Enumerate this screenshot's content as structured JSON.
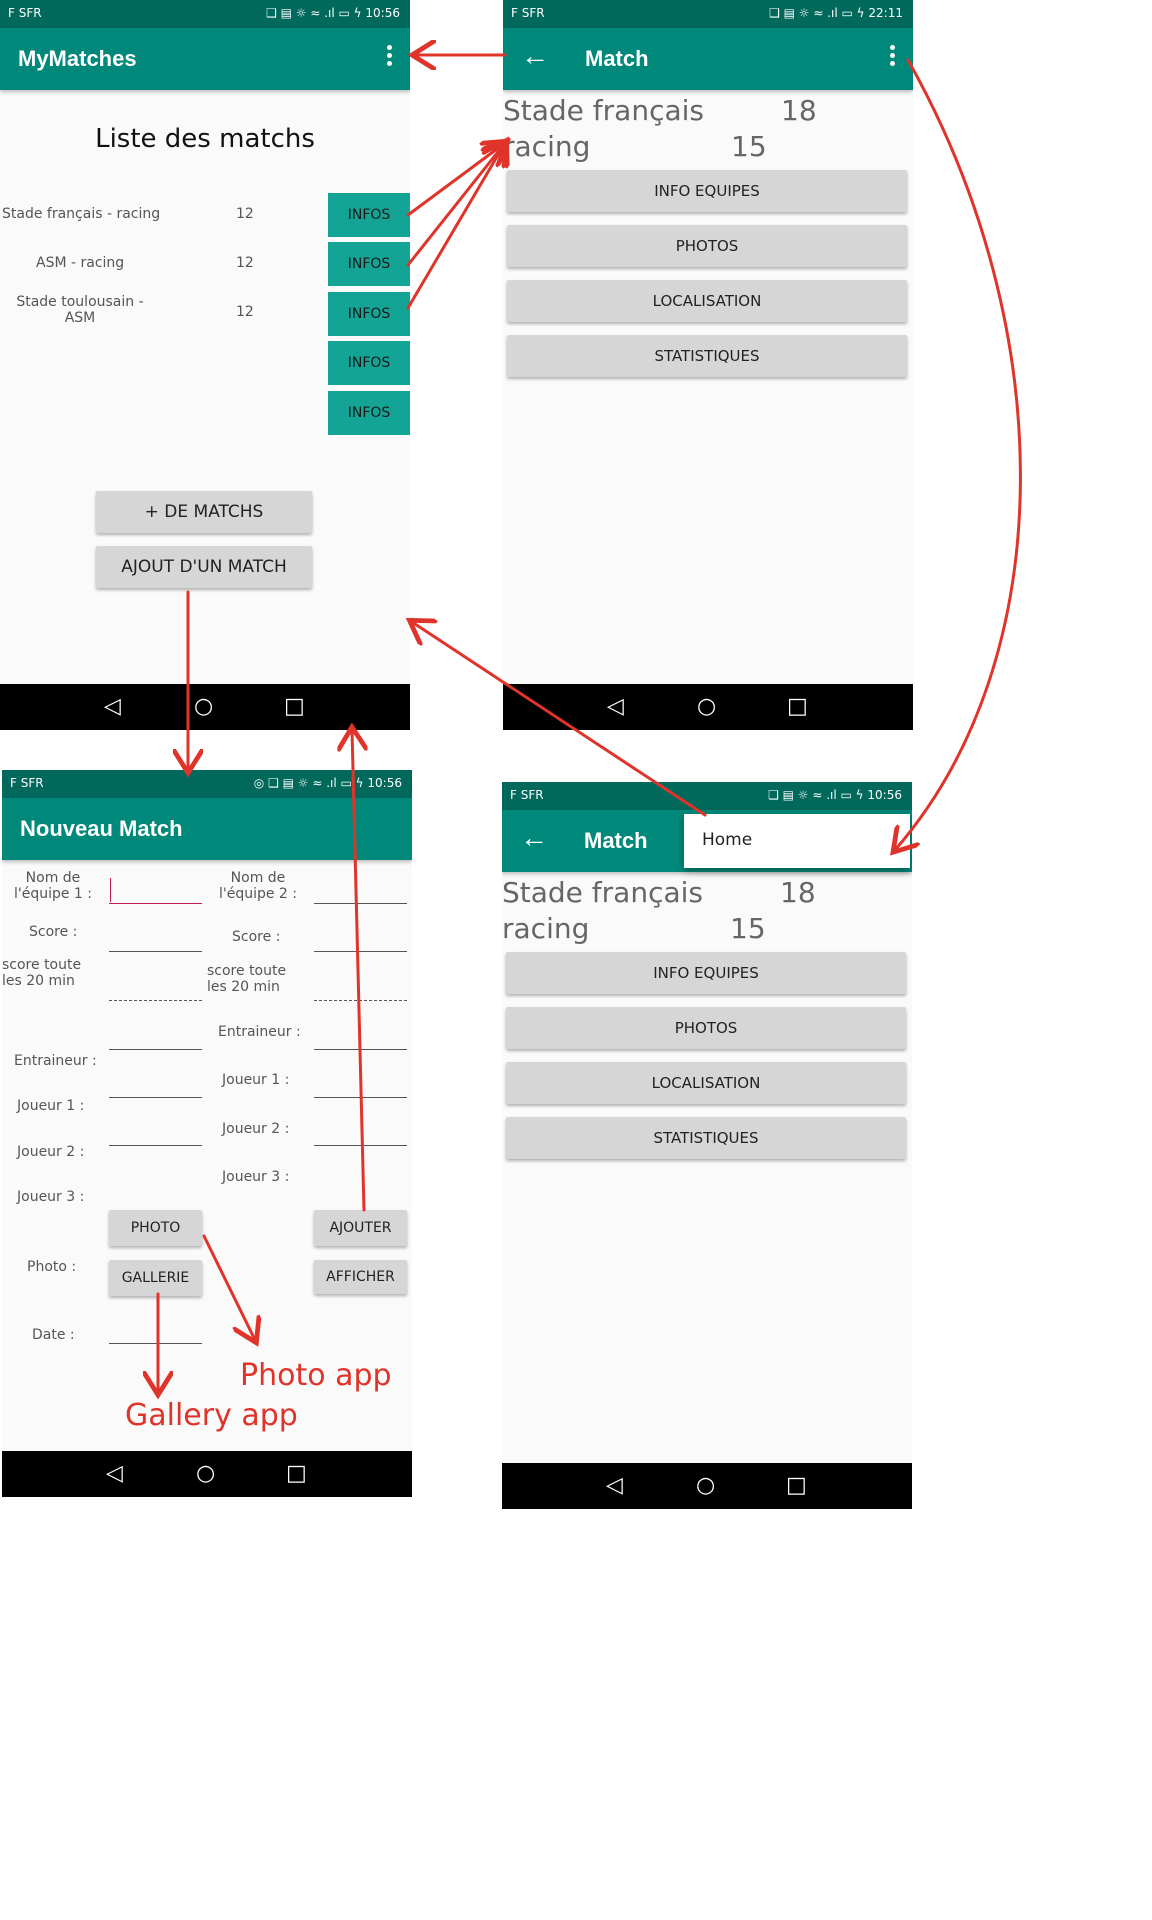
{
  "colors": {
    "primary": "#00897b",
    "primary_dark": "#00695c",
    "info_button": "#14a495",
    "annotation": "#e0342b"
  },
  "screen_list": {
    "status": {
      "carrier": "F SFR",
      "icons": "❑ ▤ ☼ ≈ .ıl ▭ ϟ 10:56"
    },
    "app_title": "MyMatches",
    "heading": "Liste des matchs",
    "matches": [
      {
        "name": "Stade français - racing",
        "score": "12"
      },
      {
        "name": "ASM - racing",
        "score": "12"
      },
      {
        "name": "Stade toulousain - ASM",
        "score": "12"
      }
    ],
    "info_buttons": [
      "INFOS",
      "INFOS",
      "INFOS",
      "INFOS",
      "INFOS"
    ],
    "more_button": "+ DE MATCHS",
    "add_button": "AJOUT D'UN MATCH"
  },
  "screen_match": {
    "status": {
      "carrier": "F SFR",
      "icons": "❑ ▤ ☼ ≈ .ıl ▭ ϟ 22:11"
    },
    "title": "Match",
    "team1": "Stade français",
    "score1": "18",
    "team2": "racing",
    "score2": "15",
    "buttons": [
      "INFO EQUIPES",
      "PHOTOS",
      "LOCALISATION",
      "STATISTIQUES"
    ]
  },
  "screen_new": {
    "status": {
      "carrier": "F SFR",
      "icons": "◎ ❑ ▤ ☼ ≈ .ıl ▭ ϟ 10:56"
    },
    "title": "Nouveau Match",
    "labels_left": [
      "Nom de l'équipe 1 :",
      "Score :",
      "score toute les 20 min",
      "Entraineur :",
      "Joueur 1 :",
      "Joueur 2 :",
      "Joueur 3 :",
      "Photo :",
      "Date :"
    ],
    "labels_right": [
      "Nom de l'équipe 2 :",
      "Score :",
      "score toute les 20 min",
      "Entraineur :",
      "Joueur 1 :",
      "Joueur 2 :",
      "Joueur 3 :"
    ],
    "photo_button": "PHOTO",
    "gallery_button": "GALLERIE",
    "add_button": "AJOUTER",
    "show_button": "AFFICHER"
  },
  "screen_menu": {
    "status": {
      "carrier": "F SFR",
      "icons": "❑ ▤ ☼ ≈ .ıl ▭ ϟ 10:56"
    },
    "title": "Match",
    "menu_item": "Home",
    "team1": "Stade français",
    "score1": "18",
    "team2": "racing",
    "score2": "15",
    "buttons": [
      "INFO EQUIPES",
      "PHOTOS",
      "LOCALISATION",
      "STATISTIQUES"
    ]
  },
  "annotations": {
    "photo_app": "Photo app",
    "gallery_app": "Gallery app"
  },
  "nav": {
    "back": "◁",
    "home": "○",
    "recents": "□"
  }
}
